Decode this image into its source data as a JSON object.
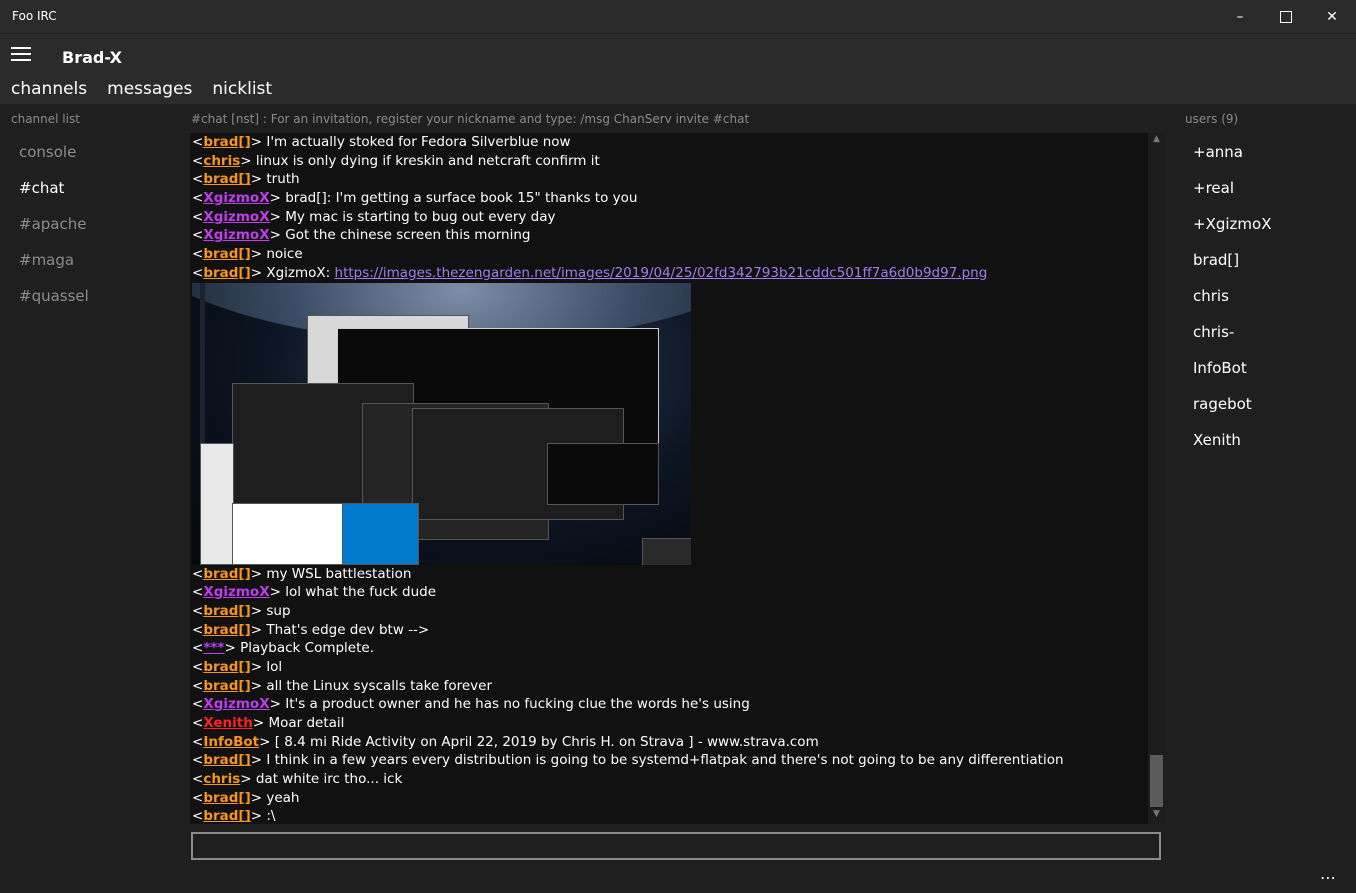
{
  "window": {
    "title": "Foo IRC"
  },
  "header": {
    "server_name": "Brad-X",
    "tabs": [
      "channels",
      "messages",
      "nicklist"
    ]
  },
  "columns": {
    "channel_list_label": "channel list",
    "topic": "#chat [nst] : For an invitation, register your nickname and type: /msg ChanServ invite #chat",
    "users_label": "users (9)"
  },
  "channels": [
    {
      "name": "console",
      "active": false
    },
    {
      "name": "#chat",
      "active": true
    },
    {
      "name": "#apache",
      "active": false
    },
    {
      "name": "#maga",
      "active": false
    },
    {
      "name": "#quassel",
      "active": false
    }
  ],
  "users": [
    "+anna",
    "+real",
    "+XgizmoX",
    "brad[]",
    "chris",
    "chris-",
    "InfoBot",
    "ragebot",
    "Xenith"
  ],
  "nick_colors": {
    "brad[]": "#f7941d",
    "chris": "#f7941d",
    "XgizmoX": "#c13cf0",
    "***": "#c13cf0",
    "Xenith": "#ff2020",
    "InfoBot": "#f7941d"
  },
  "messages_before": [
    {
      "nick": "brad[]",
      "text": "I'm actually stoked for Fedora Silverblue now"
    },
    {
      "nick": "chris",
      "text": "linux is only dying if kreskin and netcraft confirm it"
    },
    {
      "nick": "brad[]",
      "text": "truth"
    },
    {
      "nick": "XgizmoX",
      "text": "brad[]: I'm getting a surface book 15\" thanks to you"
    },
    {
      "nick": "XgizmoX",
      "text": "My mac is starting to bug out every day"
    },
    {
      "nick": "XgizmoX",
      "text": "Got the chinese screen this morning"
    },
    {
      "nick": "brad[]",
      "text": "noice"
    },
    {
      "nick": "brad[]",
      "text": "XgizmoX: ",
      "link": "https://images.thezengarden.net/images/2019/04/25/02fd342793b21cddc501ff7a6d0b9d97.png"
    }
  ],
  "messages_after": [
    {
      "nick": "brad[]",
      "text": "my WSL battlestation"
    },
    {
      "nick": "XgizmoX",
      "text": "lol what the fuck dude"
    },
    {
      "nick": "brad[]",
      "text": "sup"
    },
    {
      "nick": "brad[]",
      "text": "That's edge dev btw -->"
    },
    {
      "nick": "***",
      "text": "Playback Complete."
    },
    {
      "nick": "brad[]",
      "text": "lol"
    },
    {
      "nick": "brad[]",
      "text": "all the Linux syscalls take forever"
    },
    {
      "nick": "XgizmoX",
      "text": "It's a product owner and he has no fucking clue the words he's using"
    },
    {
      "nick": "Xenith",
      "text": "Moar detail"
    },
    {
      "nick": "InfoBot",
      "text": "[ 8.4 mi Ride Activity on April 22, 2019 by Chris H. on Strava ] - www.strava.com"
    },
    {
      "nick": "brad[]",
      "text": "I think in a few years every distribution is going to be systemd+flatpak and there's not going to be any differentiation"
    },
    {
      "nick": "chris",
      "text": "dat white irc tho... ick"
    },
    {
      "nick": "brad[]",
      "text": "yeah"
    },
    {
      "nick": "brad[]",
      "text": ":\\"
    }
  ],
  "input": {
    "value": ""
  }
}
